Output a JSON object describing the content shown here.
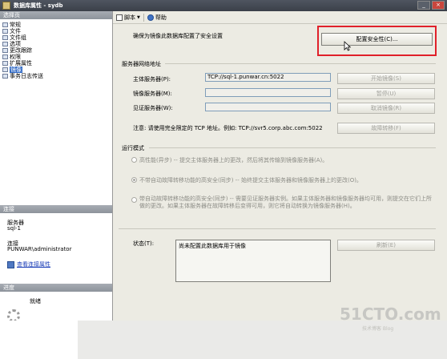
{
  "window": {
    "title": "数据库属性 - sydb"
  },
  "left": {
    "select_page_header": "选择页",
    "pages": [
      {
        "label": "常规",
        "selected": false
      },
      {
        "label": "文件",
        "selected": false
      },
      {
        "label": "文件组",
        "selected": false
      },
      {
        "label": "选项",
        "selected": false
      },
      {
        "label": "更改跟踪",
        "selected": false
      },
      {
        "label": "权限",
        "selected": false
      },
      {
        "label": "扩展属性",
        "selected": false
      },
      {
        "label": "镜像",
        "selected": true
      },
      {
        "label": "事务日志传送",
        "selected": false
      }
    ],
    "connection_header": "连接",
    "server_label": "服务器",
    "server_value": "sql-1",
    "connection_label": "连接",
    "connection_value": "PUNWAR\\administrator",
    "view_connection_link": "查看连接属性",
    "progress_header": "进度",
    "progress_status": "就绪"
  },
  "toolbar": {
    "script_label": "脚本",
    "help_label": "帮助"
  },
  "main": {
    "intro_text": "确保为镜像此数据库配置了安全设置",
    "configure_security_button": "配置安全性(C)...",
    "server_network_section": "服务器网络地址",
    "principal_label": "主体服务器(P):",
    "principal_value": "TCP://sql-1.punwar.cn:5022",
    "mirror_label": "镜像服务器(M):",
    "mirror_value": "",
    "witness_label": "见证服务器(W):",
    "witness_value": "",
    "start_mirroring_button": "开始镜像(S)",
    "pause_button": "暂停(U)",
    "remove_mirroring_button": "取消镜像(R)",
    "failover_button": "故障转移(F)",
    "note_text": "注意: 请使用完全限定的 TCP 地址。例如: TCP://svr5.corp.abc.com:5022",
    "operating_mode_section": "运行模式",
    "modes": [
      {
        "label": "高性能(异步) -- 提交主体服务器上的更改，然后将其传输到镜像服务器(A)。",
        "selected": false
      },
      {
        "label": "不带自动故障转移功能的高安全(同步) -- 始终提交主体服务器和镜像服务器上的更改(O)。",
        "selected": true
      },
      {
        "label": "带自动故障转移功能的高安全(同步) -- 需要见证服务器实例。如果主体服务器和镜像服务器均可用，则提交在它们上所做的更改。如果主体服务器在故障转移后变得可用，则它将自动转换为镜像服务器(H)。",
        "selected": false
      }
    ],
    "status_label": "状态(T):",
    "status_value": "尚未配置此数据库用于镜像",
    "refresh_button": "刷新(E)"
  },
  "watermark": {
    "main": "51CTO.com",
    "sub": "技术博客 Blog"
  }
}
